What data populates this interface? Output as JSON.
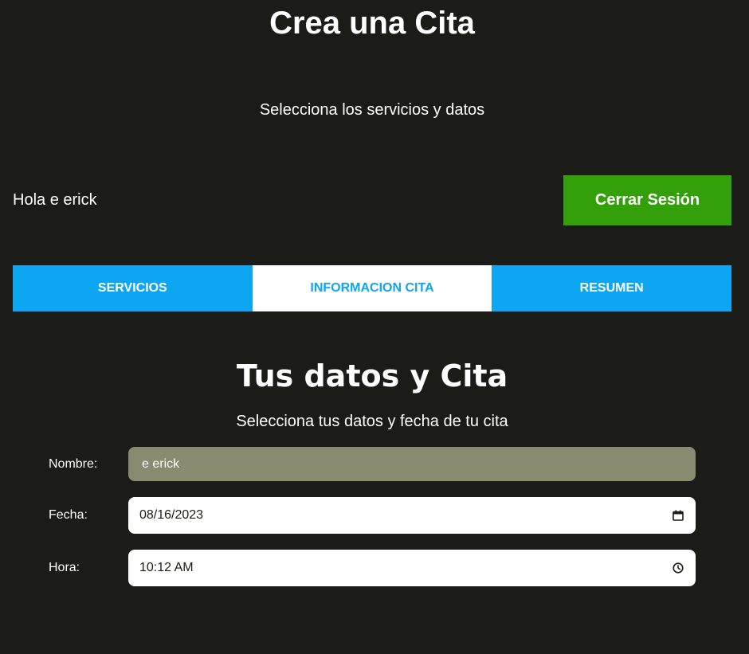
{
  "header": {
    "title": "Crea una Cita",
    "subtitle": "Selecciona los servicios y datos"
  },
  "session": {
    "greeting": "Hola e erick",
    "logout_label": "Cerrar Sesión"
  },
  "tabs": [
    {
      "label": "SERVICIOS",
      "active": false
    },
    {
      "label": "INFORMACION CITA",
      "active": true
    },
    {
      "label": "RESUMEN",
      "active": false
    }
  ],
  "section": {
    "title": "Tus datos y Cita",
    "subtitle": "Selecciona tus datos y fecha de tu cita"
  },
  "form": {
    "name": {
      "label": "Nombre:",
      "value": "e erick"
    },
    "date": {
      "label": "Fecha:",
      "value": "08/16/2023",
      "icon": "calendar-icon"
    },
    "time": {
      "label": "Hora:",
      "value": "10:12 AM",
      "icon": "clock-icon"
    }
  },
  "colors": {
    "background": "#1b1b17",
    "accent_green": "#33a00a",
    "accent_blue": "#0da6f2",
    "readonly_field": "#888b6f"
  }
}
